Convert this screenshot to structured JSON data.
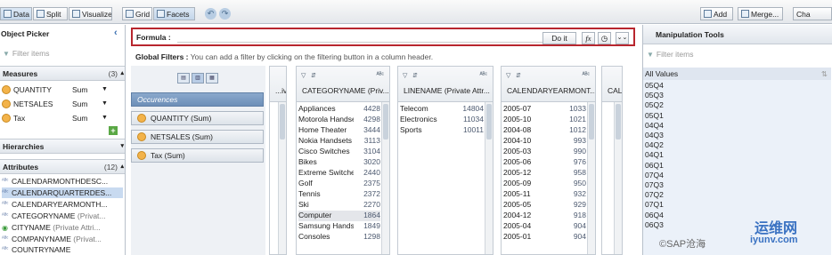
{
  "toolbar": {
    "data": "Data",
    "split": "Split",
    "visualize": "Visualize",
    "grid": "Grid",
    "facets": "Facets",
    "add": "Add",
    "merge": "Merge...",
    "cha": "Cha"
  },
  "object_picker": {
    "title": "Object Picker",
    "filter_placeholder": "Filter items",
    "measures": {
      "title": "Measures",
      "count": "(3)",
      "items": [
        {
          "name": "QUANTITY",
          "agg": "Sum"
        },
        {
          "name": "NETSALES",
          "agg": "Sum"
        },
        {
          "name": "Tax",
          "agg": "Sum"
        }
      ]
    },
    "hierarchies": {
      "title": "Hierarchies"
    },
    "attributes": {
      "title": "Attributes",
      "count": "(12)",
      "items": [
        {
          "name": "CALENDARMONTHDESC...",
          "sub": ""
        },
        {
          "name": "CALENDARQUARTERDES...",
          "sub": ""
        },
        {
          "name": "CALENDARYEARMONTH...",
          "sub": ""
        },
        {
          "name": "CATEGORYNAME",
          "sub": "(Privat..."
        },
        {
          "name": "CITYNAME",
          "sub": "(Private Attri..."
        },
        {
          "name": "COMPANYNAME",
          "sub": "(Privat..."
        },
        {
          "name": "COUNTRYNAME",
          "sub": ""
        }
      ]
    }
  },
  "formula": {
    "label": "Formula :",
    "do_it": "Do it",
    "fx": "fx"
  },
  "global_filters": {
    "label": "Global Filters :",
    "hint": "You can add a filter by clicking on the filtering button in a column header."
  },
  "facet_measures": [
    "Occurences",
    "QUANTITY (Sum)",
    "NETSALES (Sum)",
    "Tax (Sum)"
  ],
  "columns": [
    {
      "title": "...ivat...",
      "values": [
        [
          "",
          ""
        ]
      ]
    },
    {
      "title": "CATEGORYNAME (Priv...",
      "values": [
        [
          "Appliances",
          "4428"
        ],
        [
          "Motorola Handsets",
          "4298"
        ],
        [
          "Home Theater",
          "3444"
        ],
        [
          "Nokia Handsets",
          "3113"
        ],
        [
          "Cisco Switches",
          "3104"
        ],
        [
          "Bikes",
          "3020"
        ],
        [
          "Extreme Switches",
          "2440"
        ],
        [
          "Golf",
          "2375"
        ],
        [
          "Tennis",
          "2372"
        ],
        [
          "Ski",
          "2270"
        ],
        [
          "Computer",
          "1864"
        ],
        [
          "Samsung Handsets",
          "1849"
        ],
        [
          "Consoles",
          "1298"
        ]
      ]
    },
    {
      "title": "LINENAME (Private Attr...",
      "values": [
        [
          "Telecom",
          "14804"
        ],
        [
          "Electronics",
          "11034"
        ],
        [
          "Sports",
          "10011"
        ]
      ]
    },
    {
      "title": "CALENDARYEARMONT...",
      "values": [
        [
          "2005-07",
          "1033"
        ],
        [
          "2005-10",
          "1021"
        ],
        [
          "2004-08",
          "1012"
        ],
        [
          "2004-10",
          "993"
        ],
        [
          "2005-03",
          "990"
        ],
        [
          "2005-06",
          "976"
        ],
        [
          "2005-12",
          "958"
        ],
        [
          "2005-09",
          "950"
        ],
        [
          "2005-11",
          "932"
        ],
        [
          "2005-05",
          "929"
        ],
        [
          "2004-12",
          "918"
        ],
        [
          "2005-04",
          "904"
        ],
        [
          "2005-01",
          "904"
        ]
      ]
    },
    {
      "title": "CAL...",
      "values": [
        [
          "05Q3",
          ""
        ],
        [
          "05Q1",
          ""
        ],
        [
          "05Q2",
          ""
        ],
        [
          "04Q4",
          ""
        ],
        [
          "05Q4",
          ""
        ],
        [
          "04Q3",
          ""
        ],
        [
          "04Q1",
          ""
        ],
        [
          "04Q2",
          ""
        ],
        [
          "06Q1",
          ""
        ],
        [
          "07Q4",
          ""
        ],
        [
          "06Q2",
          ""
        ],
        [
          "07Q1",
          ""
        ],
        [
          "07Q3",
          ""
        ],
        [
          "05Q3",
          ""
        ]
      ]
    }
  ],
  "manipulation_tools": {
    "title": "Manipulation Tools",
    "filter_placeholder": "Filter items",
    "all_values": "All Values",
    "values": [
      "05Q4",
      "05Q3",
      "05Q2",
      "05Q1",
      "04Q4",
      "04Q3",
      "04Q2",
      "04Q1",
      "06Q1",
      "07Q4",
      "07Q3",
      "07Q2",
      "07Q1",
      "06Q4",
      "06Q3"
    ]
  },
  "watermark": {
    "line1": "运维网",
    "line2": "iyunv.com",
    "credit": "©SAP沧海"
  }
}
